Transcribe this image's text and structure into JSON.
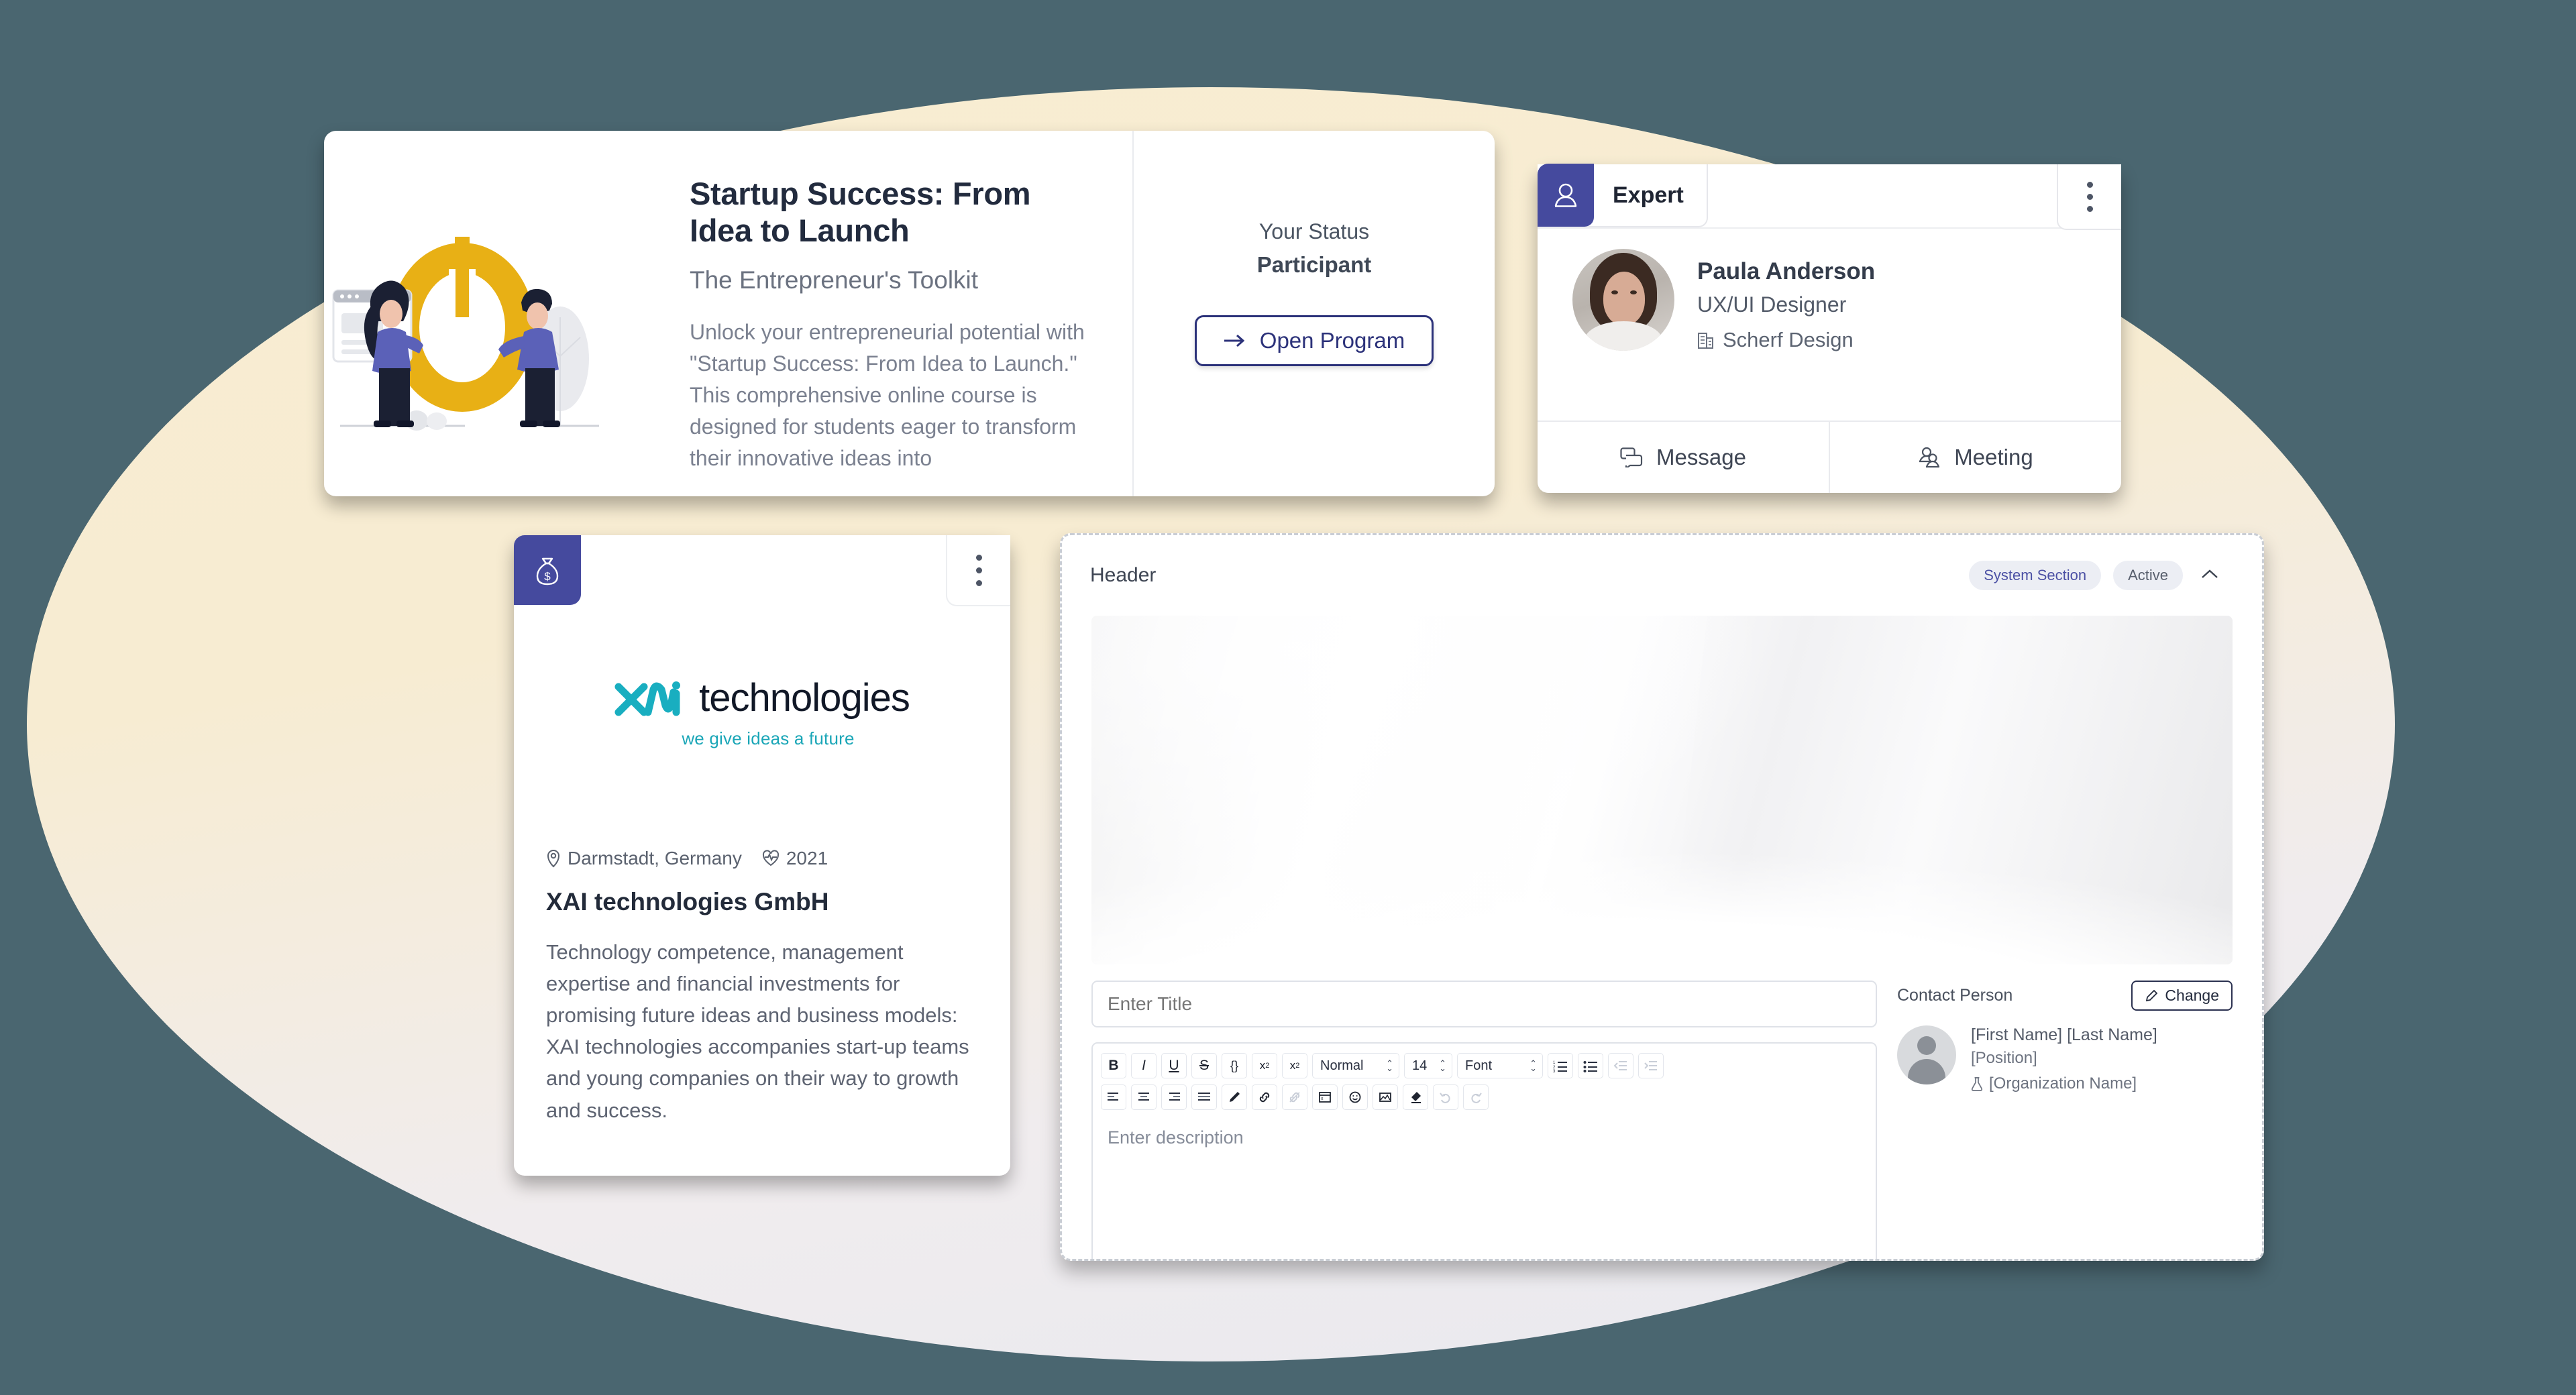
{
  "program_card": {
    "title": "Startup Success: From Idea to Launch",
    "subtitle": "The Entrepreneur's Toolkit",
    "description": "Unlock your entrepreneurial potential with \"Startup Success: From Idea to Launch.\" This comprehensive online course is designed for students eager to transform their innovative ideas into",
    "status_label": "Your Status",
    "status_value": "Participant",
    "open_button": "Open Program",
    "arrow_icon": "arrow-right-icon"
  },
  "expert_card": {
    "tab_label": "Expert",
    "tab_icon": "person-icon",
    "kebab_icon": "more-vertical-icon",
    "name": "Paula Anderson",
    "role": "UX/UI Designer",
    "organization": "Scherf Design",
    "org_icon": "building-icon",
    "actions": [
      {
        "label": "Message",
        "icon": "chat-icon"
      },
      {
        "label": "Meeting",
        "icon": "people-icon"
      }
    ]
  },
  "company_card": {
    "badge_icon": "money-bag-icon",
    "kebab_icon": "more-vertical-icon",
    "logo_mark": "xai-logo-mark",
    "logo_word": "technologies",
    "tagline": "we give ideas a future",
    "location": "Darmstadt, Germany",
    "location_icon": "map-pin-icon",
    "founded": "2021",
    "founded_icon": "heartbeat-icon",
    "name": "XAI technologies GmbH",
    "description": "Technology competence, management expertise and financial investments for promising future ideas and business models: XAI technologies accompanies start-up teams and young companies on their way to growth and success."
  },
  "header_panel": {
    "title": "Header",
    "badges": [
      "System Section",
      "Active"
    ],
    "collapse_icon": "chevron-up-icon",
    "hero_alt": "abstract-header-image",
    "title_placeholder": "Enter Title",
    "title_value": "",
    "description_placeholder": "Enter description",
    "toolbar": {
      "row1": [
        {
          "name": "bold-icon",
          "glyph": "B"
        },
        {
          "name": "italic-icon",
          "glyph": "I"
        },
        {
          "name": "underline-icon",
          "glyph": "U"
        },
        {
          "name": "strikethrough-icon",
          "glyph": "S"
        },
        {
          "name": "code-block-icon",
          "glyph": "{}"
        },
        {
          "name": "superscript-icon",
          "glyph": "x²"
        },
        {
          "name": "subscript-icon",
          "glyph": "x₂"
        }
      ],
      "selects": [
        {
          "name": "text-style-select",
          "value": "Normal"
        },
        {
          "name": "font-size-select",
          "value": "14"
        },
        {
          "name": "font-family-select",
          "value": "Font"
        }
      ],
      "row1_end": [
        {
          "name": "ordered-list-icon",
          "glyph": "☰"
        },
        {
          "name": "bullet-list-icon",
          "glyph": "☰"
        },
        {
          "name": "outdent-icon",
          "glyph": "⇤",
          "dim": true
        },
        {
          "name": "indent-icon",
          "glyph": "⇥",
          "dim": true
        }
      ],
      "row2": [
        {
          "name": "align-left-icon",
          "glyph": "≡"
        },
        {
          "name": "align-center-icon",
          "glyph": "≡"
        },
        {
          "name": "align-right-icon",
          "glyph": "≡"
        },
        {
          "name": "align-justify-icon",
          "glyph": "≡"
        },
        {
          "name": "highlight-pen-icon",
          "glyph": "✎"
        },
        {
          "name": "link-icon",
          "glyph": "🔗"
        },
        {
          "name": "unlink-icon",
          "glyph": "🔗",
          "dim": true
        },
        {
          "name": "insert-table-icon",
          "glyph": "▦"
        },
        {
          "name": "emoji-icon",
          "glyph": "☺"
        },
        {
          "name": "insert-image-icon",
          "glyph": "🖼"
        },
        {
          "name": "clear-format-icon",
          "glyph": "◧"
        },
        {
          "name": "undo-icon",
          "glyph": "↺",
          "dim": true
        },
        {
          "name": "redo-icon",
          "glyph": "↻",
          "dim": true
        }
      ]
    },
    "contact": {
      "title": "Contact Person",
      "change_label": "Change",
      "change_icon": "pencil-icon",
      "name": "[First Name] [Last Name]",
      "position": "[Position]",
      "organization": "[Organization Name]",
      "org_icon": "flask-icon"
    }
  },
  "colors": {
    "background": "#4a6670",
    "blob_top": "#f8edd2",
    "blob_bottom": "#e8e9ef",
    "accent_indigo": "#454a9e",
    "accent_yellow": "#e8b015",
    "accent_teal": "#1aa6b7",
    "button_outline": "#2c327a"
  }
}
